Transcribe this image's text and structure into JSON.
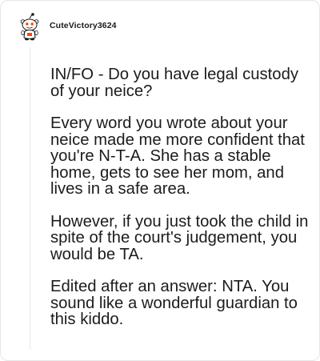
{
  "comment": {
    "username": "CuteVictory3624",
    "avatar_icon": "snoo-avatar-icon",
    "paragraphs": [
      "IN/FO - Do you have legal custody of your neice?",
      "Every word you wrote about your neice made me more confident that you're N-T-A. She has a stable home, gets to see her mom, and lives in a safe area.",
      "However, if you just took the child in spite of the court's judgement, you would be TA.",
      "Edited after an answer: NTA. You sound like a wonderful guardian to this kiddo."
    ]
  },
  "colors": {
    "text": "#1c1c1c",
    "username": "#1a1a1b",
    "border": "#e6e6e6",
    "thread_line": "#ebebeb",
    "avatar_accent": "#ff4500"
  }
}
